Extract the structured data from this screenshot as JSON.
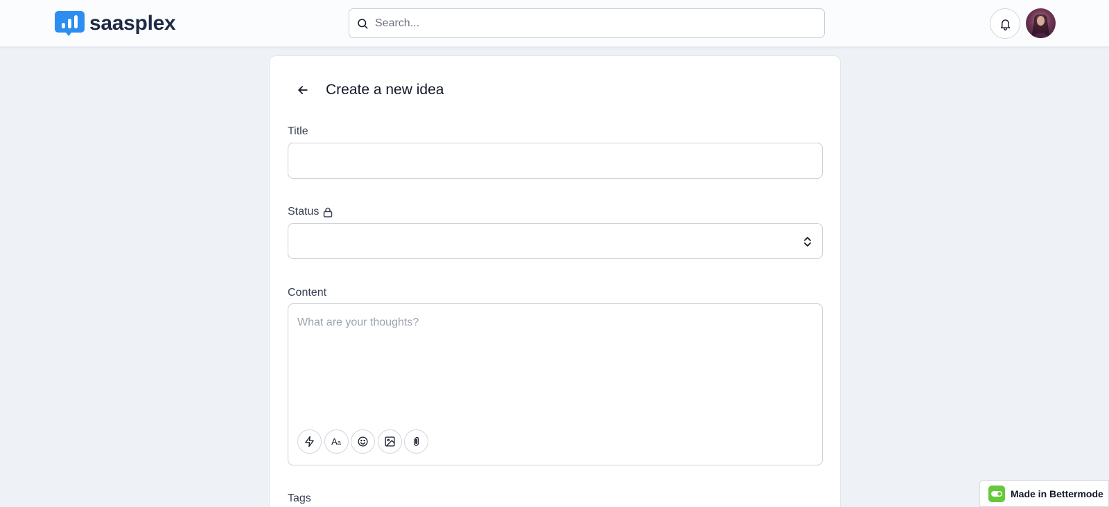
{
  "app": {
    "name": "saasplex"
  },
  "header": {
    "search": {
      "placeholder": "Search...",
      "value": ""
    },
    "icons": [
      "logo-icon",
      "search-icon",
      "bell-icon",
      "user-avatar"
    ]
  },
  "form": {
    "title": "Create a new idea",
    "fields": {
      "title": {
        "label": "Title",
        "value": ""
      },
      "status": {
        "label": "Status",
        "value": "",
        "locked": true
      },
      "content": {
        "label": "Content",
        "placeholder": "What are your thoughts?",
        "value": ""
      },
      "tags": {
        "label": "Tags"
      }
    },
    "toolbar": [
      {
        "name": "lightning-icon"
      },
      {
        "name": "text-format-icon",
        "glyph": "Aa"
      },
      {
        "name": "emoji-icon"
      },
      {
        "name": "image-icon"
      },
      {
        "name": "attachment-icon"
      }
    ]
  },
  "badge": {
    "label": "Made in Bettermode",
    "accent": "#66c93a"
  },
  "colors": {
    "brand": "#2b8ef0",
    "background": "#eef1f6",
    "text": "#111827"
  }
}
